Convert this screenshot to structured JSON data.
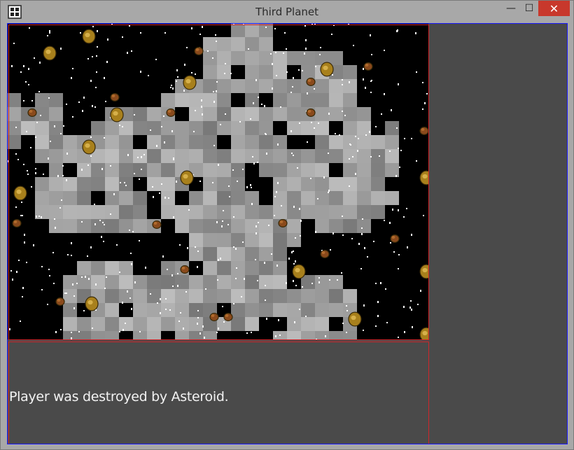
{
  "window": {
    "title": "Third Planet",
    "min_glyph": "—",
    "max_glyph": "☐",
    "close_glyph": "✕"
  },
  "game": {
    "message": "Player was destroyed by Asteroid.",
    "colors": {
      "space": "#000000",
      "star": "#ffffff",
      "asteroid_large": "#a8801c",
      "asteroid_small": "#8a4a1c",
      "hud_background": "#4a4a4a",
      "debug_outline_red": "#d0252a",
      "debug_outline_blue": "#1a1aff"
    }
  }
}
